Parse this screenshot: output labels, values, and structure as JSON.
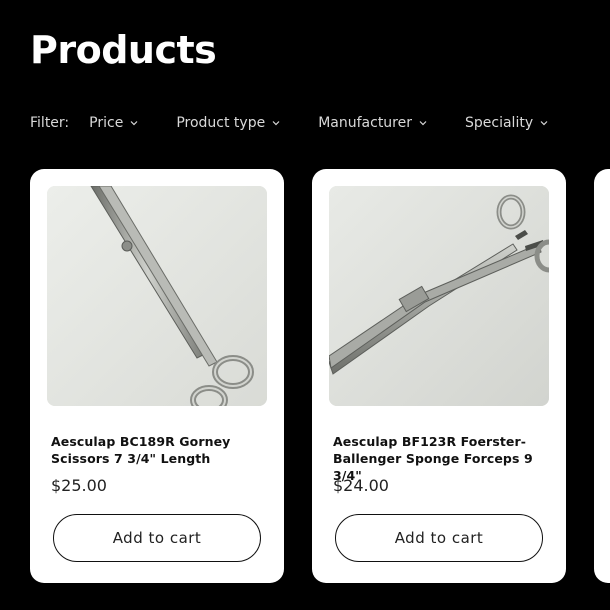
{
  "page": {
    "title": "Products"
  },
  "filters": {
    "label": "Filter:",
    "items": [
      {
        "label": "Price",
        "icon": "chevron-down-icon"
      },
      {
        "label": "Product type",
        "icon": "chevron-down-icon"
      },
      {
        "label": "Manufacturer",
        "icon": "chevron-down-icon"
      },
      {
        "label": "Speciality",
        "icon": "chevron-down-icon"
      }
    ]
  },
  "products": [
    {
      "title": "Aesculap BC189R Gorney Scissors 7 3/4\" Length",
      "title_line1": "Aesculap BC189R Gorney",
      "title_line2": "Scissors 7 3/4\" Length",
      "price": "$25.00",
      "button_label": "Add to cart",
      "image": "surgical-scissors-photo"
    },
    {
      "title": "Aesculap BF123R Foerster-Ballenger Sponge Forceps 9 3/4\"",
      "title_line1": "Aesculap BF123R Foerster-",
      "title_line2": "Ballenger Sponge Forceps 9 3/4\"",
      "price": "$24.00",
      "button_label": "Add to cart",
      "image": "sponge-forceps-photo"
    }
  ],
  "colors": {
    "background": "#000000",
    "card": "#ffffff",
    "text": "#111111"
  }
}
